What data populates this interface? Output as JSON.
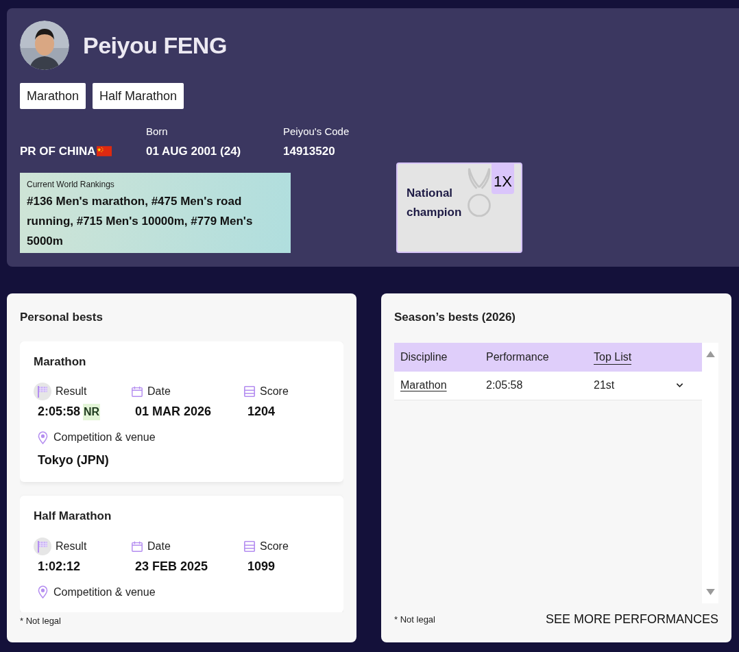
{
  "athlete": {
    "name": "Peiyou FENG",
    "disciplines": [
      "Marathon",
      "Half Marathon"
    ],
    "country": "PR OF CHINA",
    "born_label": "Born",
    "born": "01 AUG 2001 (24)",
    "code_label": "Peiyou's Code",
    "code": "14913520"
  },
  "rankings": {
    "title": "Current World Rankings",
    "text": "#136 Men's marathon, #475 Men's road running, #715 Men's 10000m, #779 Men's 5000m"
  },
  "honours": [
    {
      "title": "National champion",
      "count": "1X"
    }
  ],
  "personal_bests": {
    "title": "Personal bests",
    "cards": [
      {
        "discipline": "Marathon",
        "result_label": "Result",
        "result": "2:05:58",
        "record": "NR",
        "date_label": "Date",
        "date": "01 MAR 2026",
        "score_label": "Score",
        "score": "1204",
        "venue_label": "Competition & venue",
        "venue": "Tokyo (JPN)"
      },
      {
        "discipline": "Half Marathon",
        "result_label": "Result",
        "result": "1:02:12",
        "date_label": "Date",
        "date": "23 FEB 2025",
        "score_label": "Score",
        "score": "1099",
        "venue_label": "Competition & venue"
      }
    ],
    "footnote": "* Not legal"
  },
  "season_bests": {
    "title": "Season’s bests (2026)",
    "columns": [
      {
        "label": "Discipline",
        "sortable": false
      },
      {
        "label": "Performance",
        "sortable": false
      },
      {
        "label": "Top List",
        "sortable": true
      }
    ],
    "rows": [
      {
        "discipline": "Marathon",
        "performance": "2:05:58",
        "top_list": "21st",
        "expanded": false
      }
    ],
    "footnote": "* Not legal",
    "more_link": "SEE MORE PERFORMANCES"
  }
}
